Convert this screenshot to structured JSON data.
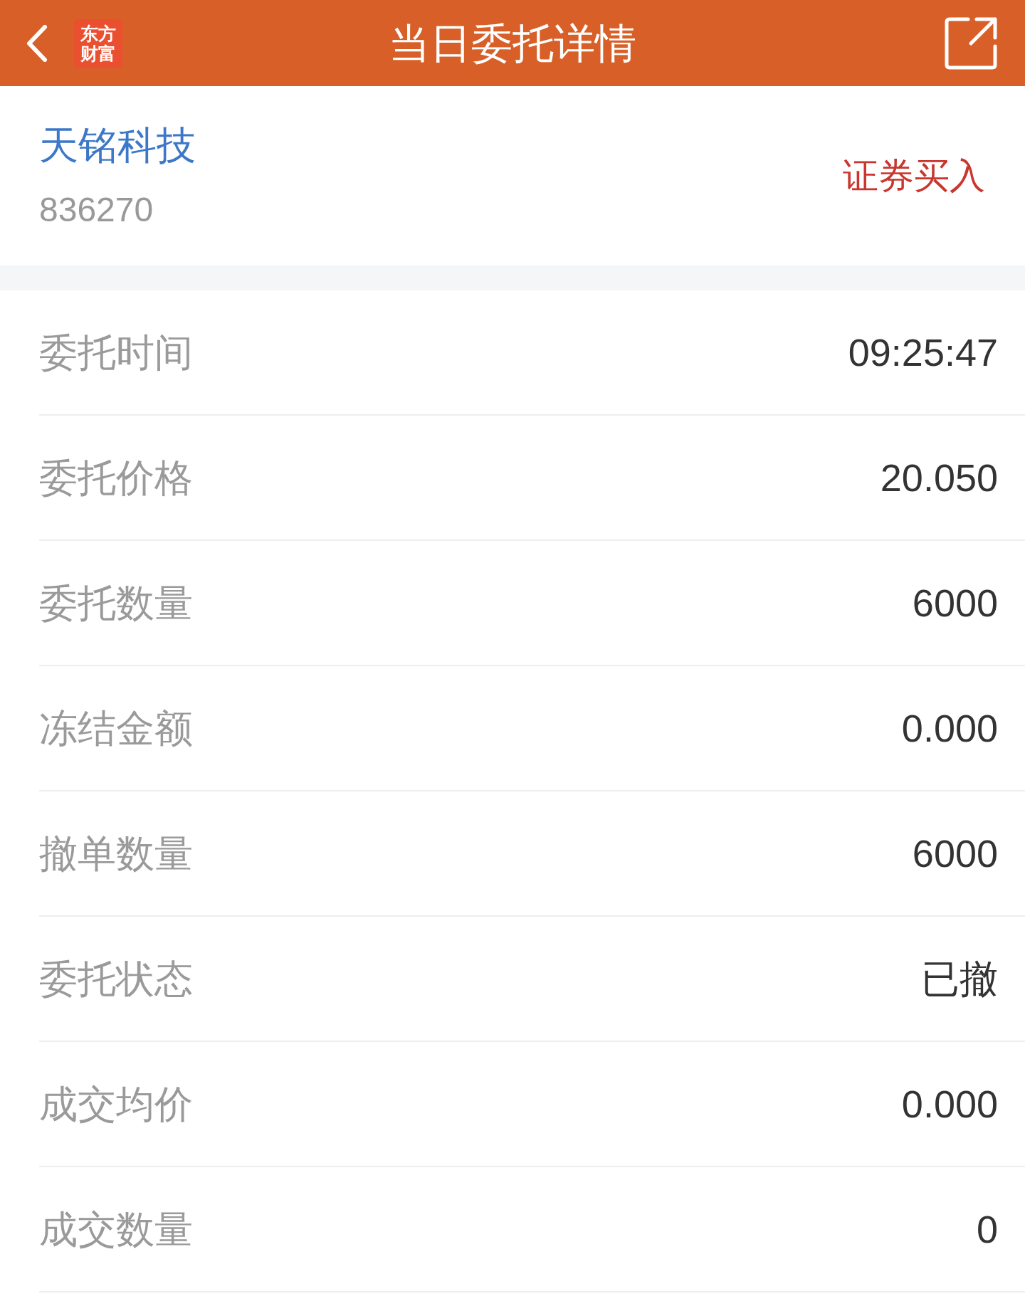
{
  "header": {
    "title": "当日委托详情",
    "logo_text": [
      "东方",
      "财富"
    ]
  },
  "stock": {
    "name": "天铭科技",
    "code": "836270",
    "action": "证券买入"
  },
  "details": [
    {
      "label": "委托时间",
      "value": "09:25:47"
    },
    {
      "label": "委托价格",
      "value": "20.050"
    },
    {
      "label": "委托数量",
      "value": "6000"
    },
    {
      "label": "冻结金额",
      "value": "0.000"
    },
    {
      "label": "撤单数量",
      "value": "6000"
    },
    {
      "label": "委托状态",
      "value": "已撤"
    },
    {
      "label": "成交均价",
      "value": "0.000"
    },
    {
      "label": "成交数量",
      "value": "0"
    }
  ]
}
